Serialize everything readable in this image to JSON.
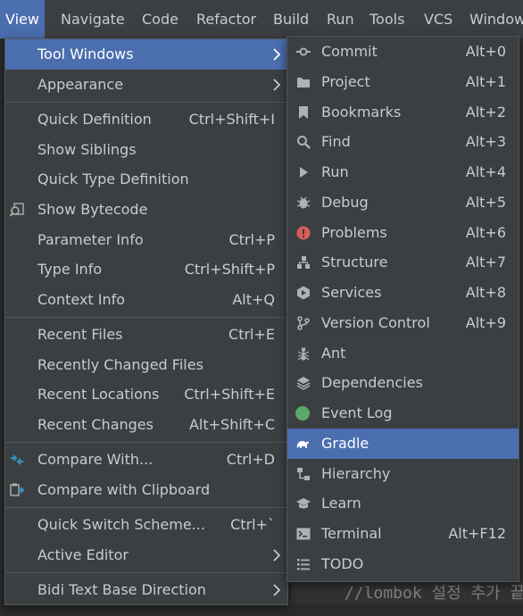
{
  "menubar": {
    "items": [
      "View",
      "Navigate",
      "Code",
      "Refactor",
      "Build",
      "Run",
      "Tools",
      "VCS",
      "Window"
    ],
    "active": "View"
  },
  "view_menu": {
    "tool_windows": "Tool Windows",
    "appearance": "Appearance",
    "quick_definition": "Quick Definition",
    "quick_definition_sc": "Ctrl+Shift+I",
    "show_siblings": "Show Siblings",
    "quick_type_definition": "Quick Type Definition",
    "show_bytecode": "Show Bytecode",
    "parameter_info": "Parameter Info",
    "parameter_info_sc": "Ctrl+P",
    "type_info": "Type Info",
    "type_info_sc": "Ctrl+Shift+P",
    "context_info": "Context Info",
    "context_info_sc": "Alt+Q",
    "recent_files": "Recent Files",
    "recent_files_sc": "Ctrl+E",
    "recently_changed_files": "Recently Changed Files",
    "recent_locations": "Recent Locations",
    "recent_locations_sc": "Ctrl+Shift+E",
    "recent_changes": "Recent Changes",
    "recent_changes_sc": "Alt+Shift+C",
    "compare_with": "Compare With...",
    "compare_with_sc": "Ctrl+D",
    "compare_with_clipboard": "Compare with Clipboard",
    "quick_switch_scheme": "Quick Switch Scheme...",
    "quick_switch_scheme_sc": "Ctrl+`",
    "active_editor": "Active Editor",
    "bidi_text_base_direction": "Bidi Text Base Direction"
  },
  "tool_windows_menu": [
    {
      "label": "Commit",
      "shortcut": "Alt+0",
      "icon": "commit-icon"
    },
    {
      "label": "Project",
      "shortcut": "Alt+1",
      "icon": "folder-icon"
    },
    {
      "label": "Bookmarks",
      "shortcut": "Alt+2",
      "icon": "bookmark-icon"
    },
    {
      "label": "Find",
      "shortcut": "Alt+3",
      "icon": "search-icon"
    },
    {
      "label": "Run",
      "shortcut": "Alt+4",
      "icon": "run-icon"
    },
    {
      "label": "Debug",
      "shortcut": "Alt+5",
      "icon": "bug-icon"
    },
    {
      "label": "Problems",
      "shortcut": "Alt+6",
      "icon": "error-icon"
    },
    {
      "label": "Structure",
      "shortcut": "Alt+7",
      "icon": "structure-icon"
    },
    {
      "label": "Services",
      "shortcut": "Alt+8",
      "icon": "services-icon"
    },
    {
      "label": "Version Control",
      "shortcut": "Alt+9",
      "icon": "vcs-branch-icon"
    },
    {
      "label": "Ant",
      "shortcut": "",
      "icon": "ant-icon"
    },
    {
      "label": "Dependencies",
      "shortcut": "",
      "icon": "layers-icon"
    },
    {
      "label": "Event Log",
      "shortcut": "",
      "icon": "event-log-icon"
    },
    {
      "label": "Gradle",
      "shortcut": "",
      "icon": "gradle-elephant-icon"
    },
    {
      "label": "Hierarchy",
      "shortcut": "",
      "icon": "hierarchy-icon"
    },
    {
      "label": "Learn",
      "shortcut": "",
      "icon": "graduation-cap-icon"
    },
    {
      "label": "Terminal",
      "shortcut": "Alt+F12",
      "icon": "terminal-icon"
    },
    {
      "label": "TODO",
      "shortcut": "",
      "icon": "todo-list-icon"
    }
  ],
  "editor": {
    "code_line": "//lombok 설정 추가 끝"
  },
  "colors": {
    "selection": "#4b6eaf",
    "menu_bg": "#3c3f41",
    "event_log_green": "#59a869",
    "error_red": "#db5c5c",
    "compare_blue": "#3592c4"
  }
}
